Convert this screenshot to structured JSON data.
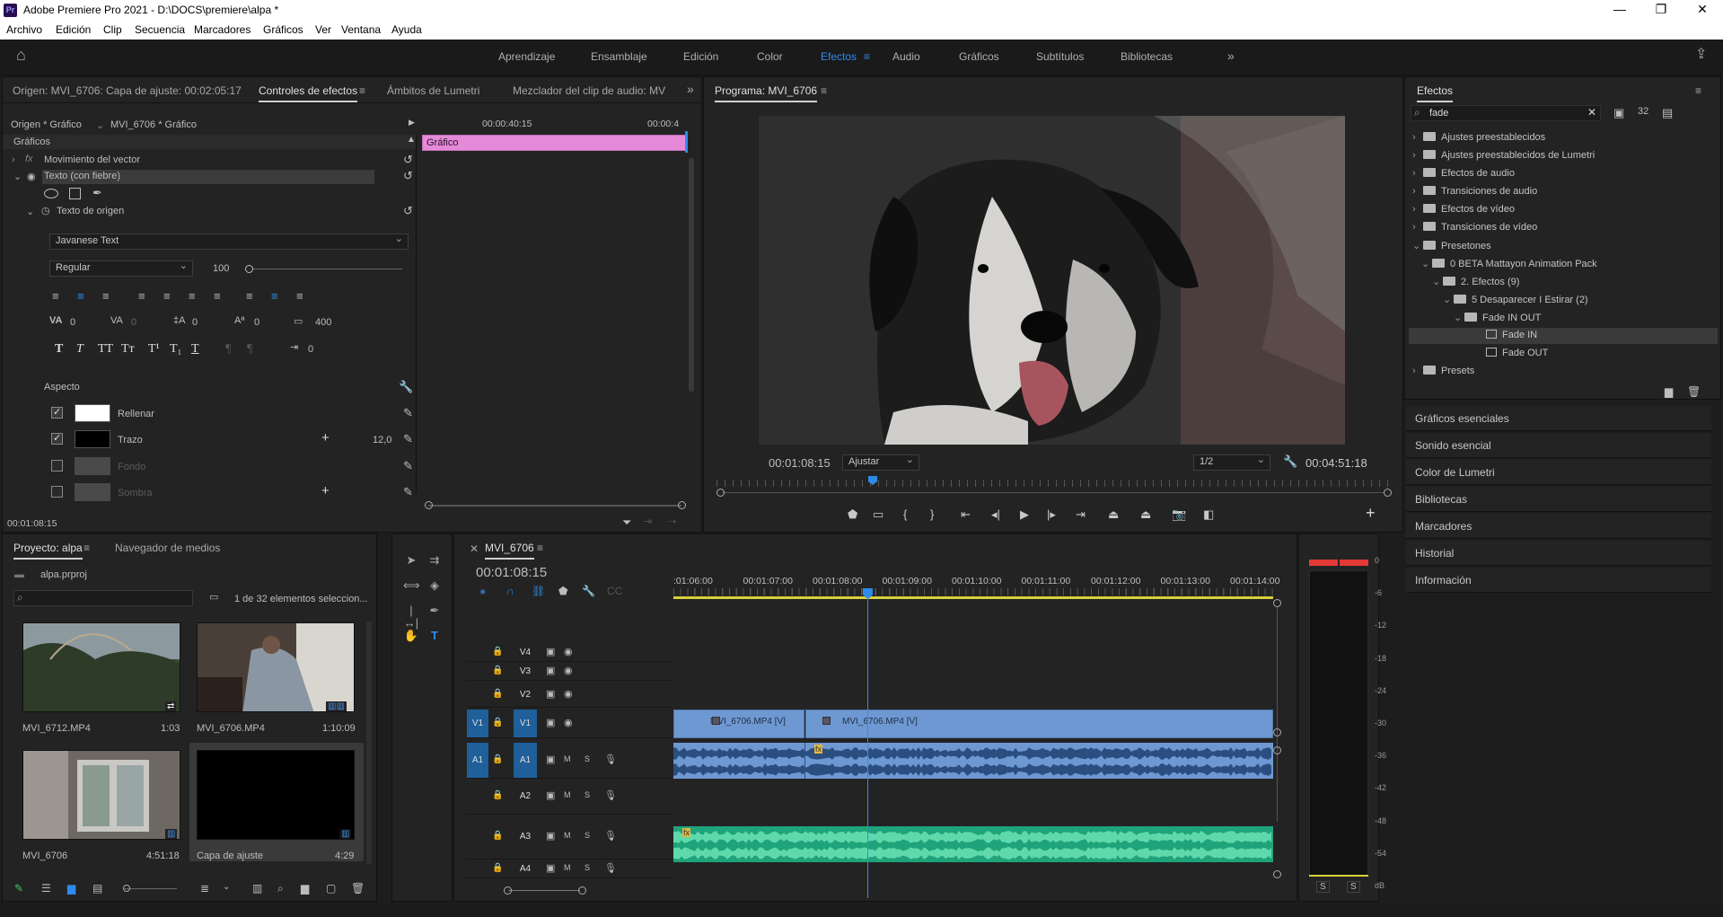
{
  "window": {
    "title": "Adobe Premiere Pro 2021 - D:\\DOCS\\premiere\\alpa *",
    "logo": "Pr"
  },
  "menu": [
    "Archivo",
    "Edición",
    "Clip",
    "Secuencia",
    "Marcadores",
    "Gráficos",
    "Ver",
    "Ventana",
    "Ayuda"
  ],
  "workspaces": [
    "Aprendizaje",
    "Ensamblaje",
    "Edición",
    "Color",
    "Efectos",
    "Audio",
    "Gráficos",
    "Subtítulos",
    "Bibliotecas"
  ],
  "active_workspace": "Efectos",
  "source_panel": {
    "tabs": [
      "Origen: MVI_6706: Capa de ajuste: 00:02:05:17",
      "Controles de efectos",
      "Ámbitos de Lumetri",
      "Mezclador del clip de audio: MVI_6"
    ],
    "origin_label": "Origen * Gráfico",
    "sequence_label": "MVI_6706 * Gráfico",
    "timecode_head": "00:00:40:15",
    "timecode_head2": "00:00:4",
    "graphic_clip": "Gráfico",
    "section": "Gráficos",
    "vector_motion": "Movimiento del vector",
    "text_layer": "Texto (con fiebre)",
    "source_text": "Texto de origen",
    "font": "Javanese Text",
    "style": "Regular",
    "size": "100",
    "tracking_vals": [
      "0",
      "0",
      "0",
      "0",
      "400"
    ],
    "baseline_val": "0",
    "appearance": "Aspecto",
    "fill": "Rellenar",
    "stroke": "Trazo",
    "stroke_width": "12,0",
    "background": "Fondo",
    "shadow": "Sombra",
    "footer_tc": "00:01:08:15",
    "type_styles": [
      "T",
      "T",
      "TT",
      "Tт",
      "T¹",
      "T₁",
      "T"
    ]
  },
  "program": {
    "title": "Programa: MVI_6706",
    "timecode": "00:01:08:15",
    "fit": "Ajustar",
    "resolution": "1/2",
    "duration": "00:04:51:18"
  },
  "effects_panel": {
    "title": "Efectos",
    "search": "fade",
    "items": [
      {
        "label": "Ajustes preestablecidos",
        "level": 0,
        "kind": "folder"
      },
      {
        "label": "Ajustes preestablecidos de Lumetri",
        "level": 0,
        "kind": "folder"
      },
      {
        "label": "Efectos de audio",
        "level": 0,
        "kind": "folder"
      },
      {
        "label": "Transiciones de audio",
        "level": 0,
        "kind": "folder"
      },
      {
        "label": "Efectos de vídeo",
        "level": 0,
        "kind": "folder"
      },
      {
        "label": "Transiciones de vídeo",
        "level": 0,
        "kind": "folder"
      },
      {
        "label": "Presetones",
        "level": 0,
        "kind": "folder"
      },
      {
        "label": "0 BETA Mattayon Animation Pack",
        "level": 1,
        "kind": "folder"
      },
      {
        "label": "2. Efectos (9)",
        "level": 2,
        "kind": "folder"
      },
      {
        "label": "5 Desaparecer I Estirar (2)",
        "level": 3,
        "kind": "folder"
      },
      {
        "label": "Fade IN OUT",
        "level": 4,
        "kind": "folder"
      },
      {
        "label": "Fade IN",
        "level": 5,
        "kind": "preset"
      },
      {
        "label": "Fade OUT",
        "level": 5,
        "kind": "preset"
      },
      {
        "label": "Presets",
        "level": 0,
        "kind": "folder"
      }
    ],
    "sections": [
      "Gráficos esenciales",
      "Sonido esencial",
      "Color de Lumetri",
      "Bibliotecas",
      "Marcadores",
      "Historial",
      "Información"
    ]
  },
  "project": {
    "tabs": [
      "Proyecto: alpa",
      "Navegador de medios"
    ],
    "file": "alpa.prproj",
    "count": "1 de 32 elementos seleccion...",
    "items": [
      {
        "name": "MVI_6712.MP4",
        "dur": "1:03"
      },
      {
        "name": "MVI_6706.MP4",
        "dur": "1:10:09"
      },
      {
        "name": "MVI_6706",
        "dur": "4:51:18"
      },
      {
        "name": "Capa de ajuste",
        "dur": "4:29"
      }
    ]
  },
  "timeline": {
    "title": "MVI_6706",
    "timecode": "00:01:08:15",
    "ruler": [
      ":01:06:00",
      "00:01:07:00",
      "00:01:08:00",
      "00:01:09:00",
      "00:01:10:00",
      "00:01:11:00",
      "00:01:12:00",
      "00:01:13:00",
      "00:01:14:00"
    ],
    "video_tracks": [
      "V4",
      "V3",
      "V2",
      "V1"
    ],
    "audio_tracks": [
      "A1",
      "A2",
      "A3",
      "A4"
    ],
    "source_patch": [
      "V1",
      "A1"
    ],
    "clips": [
      "MVI_6706.MP4 [V]",
      "MVI_6706.MP4 [V]"
    ],
    "fx_badge": "fx",
    "ms": [
      "M",
      "S"
    ]
  },
  "meter": {
    "scale": [
      "0",
      "-6",
      "-12",
      "-18",
      "-24",
      "-30",
      "-36",
      "-42",
      "-48",
      "-54",
      "dB"
    ],
    "solo": [
      "S",
      "S"
    ]
  }
}
